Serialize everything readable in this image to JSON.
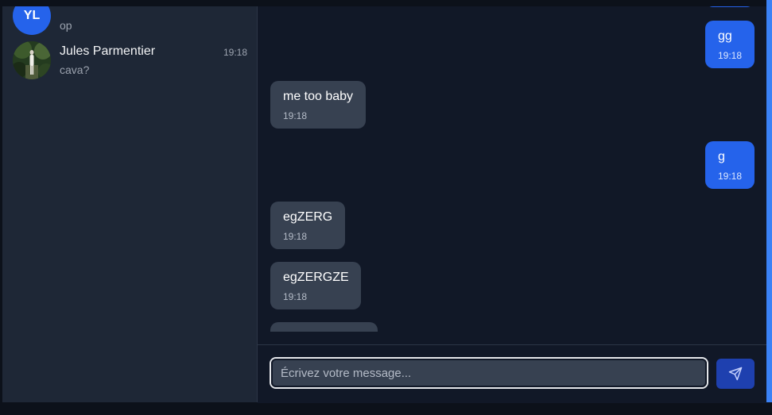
{
  "conversations": [
    {
      "avatar_initials": "YL",
      "name": "",
      "time": "",
      "preview": "op"
    },
    {
      "name": "Jules Parmentier",
      "time": "19:18",
      "preview": "cava?"
    }
  ],
  "messages": [
    {
      "direction": "outgoing",
      "text": "",
      "time": ""
    },
    {
      "direction": "outgoing",
      "text": "gg",
      "time": "19:18"
    },
    {
      "direction": "incoming",
      "text": "me too baby",
      "time": "19:18"
    },
    {
      "direction": "outgoing",
      "text": "g",
      "time": "19:18"
    },
    {
      "direction": "incoming",
      "text": "egZERG",
      "time": "19:18"
    },
    {
      "direction": "incoming",
      "text": "egZERGZE",
      "time": "19:18"
    },
    {
      "direction": "incoming",
      "text": "",
      "time": ""
    }
  ],
  "composer": {
    "placeholder": "Écrivez votre message...",
    "value": "",
    "send_icon": "paper-plane-icon"
  },
  "colors": {
    "accent": "#2563eb",
    "sidebar_bg": "#1e2736",
    "chat_bg": "#111827",
    "incoming_bubble": "#374151"
  }
}
